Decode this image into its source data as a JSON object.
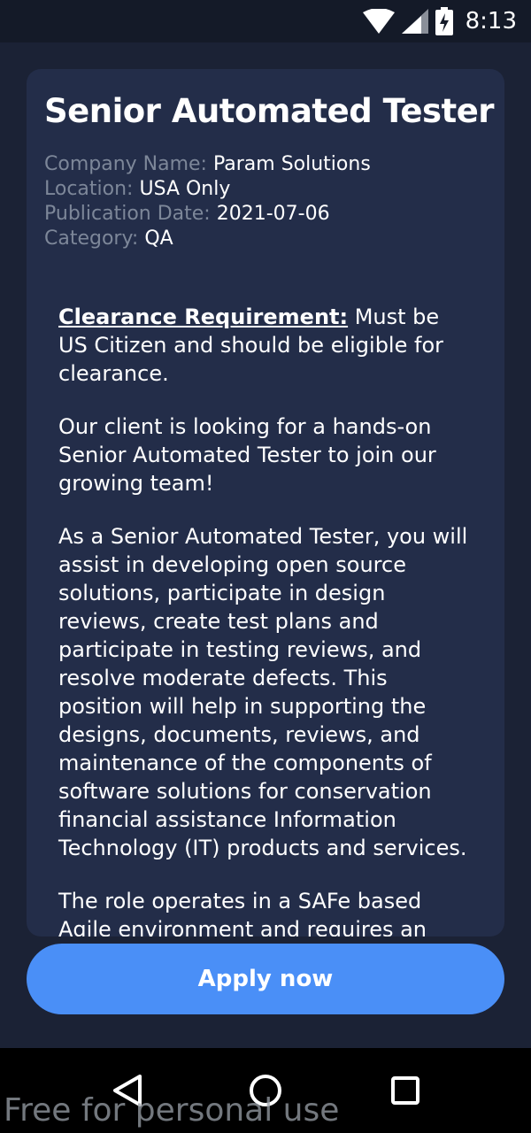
{
  "status_bar": {
    "time": "8:13",
    "icons": [
      "wifi-icon",
      "signal-icon",
      "battery-charging-icon"
    ]
  },
  "job": {
    "title": "Senior Automated Tester",
    "meta": {
      "company_label": "Company Name:",
      "company": "Param Solutions",
      "location_label": "Location:",
      "location": "USA Only",
      "date_label": "Publication Date:",
      "date": "2021-07-06",
      "category_label": "Category:",
      "category": "QA"
    },
    "description": {
      "requirement_label": "Clearance Requirement:",
      "requirement_text": " Must be US Citizen and should be eligible for clearance.",
      "p2": "Our client is looking for a hands-on Senior Automated Tester to join our growing team!",
      "p3": "As a Senior Automated Tester, you will assist in developing open source solutions, participate in design reviews, create test plans and participate in testing reviews, and resolve moderate defects. This position will help in supporting the designs, documents, reviews, and maintenance of the components of software solutions for conservation financial assistance Information Technology (IT) products and services.",
      "p4": "The role operates in a SAFe based Agile environment and requires an"
    }
  },
  "apply_button": {
    "label": "Apply now",
    "color": "#4a8ff7"
  },
  "nav_bar": {
    "icons": [
      "back-icon",
      "home-icon",
      "recents-icon"
    ]
  },
  "watermark": "Free for personal use"
}
